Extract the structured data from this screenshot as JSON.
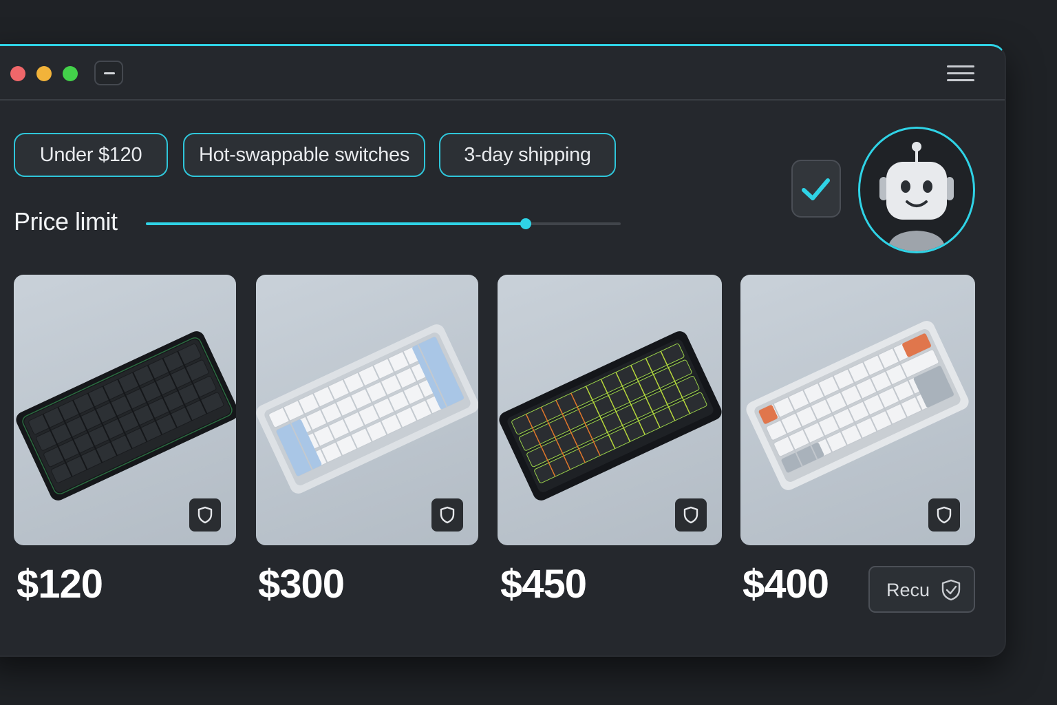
{
  "window": {
    "accent_color": "#2fd3e6",
    "controls": [
      "close",
      "minimize",
      "maximize"
    ]
  },
  "filters": {
    "chips": [
      {
        "label": "Under $120"
      },
      {
        "label": "Hot-swappable switches"
      },
      {
        "label": "3-day shipping"
      }
    ]
  },
  "price_filter": {
    "label": "Price limit",
    "slider_fraction": 0.8
  },
  "assistant": {
    "confirm_icon": "check-icon",
    "avatar_icon": "robot-icon"
  },
  "products": [
    {
      "price": "$120",
      "image": "black 60% keyboard",
      "badge_icon": "shield-icon"
    },
    {
      "price": "$300",
      "image": "white and blue 60% keyboard",
      "badge_icon": "shield-icon"
    },
    {
      "price": "$450",
      "image": "black RGB 60% keyboard",
      "badge_icon": "shield-icon"
    },
    {
      "price": "$400",
      "image": "white gray orange 60% keyboard",
      "badge_icon": "shield-icon"
    }
  ],
  "recommend_button": {
    "label": "Recu",
    "icon": "shield-check-icon"
  }
}
